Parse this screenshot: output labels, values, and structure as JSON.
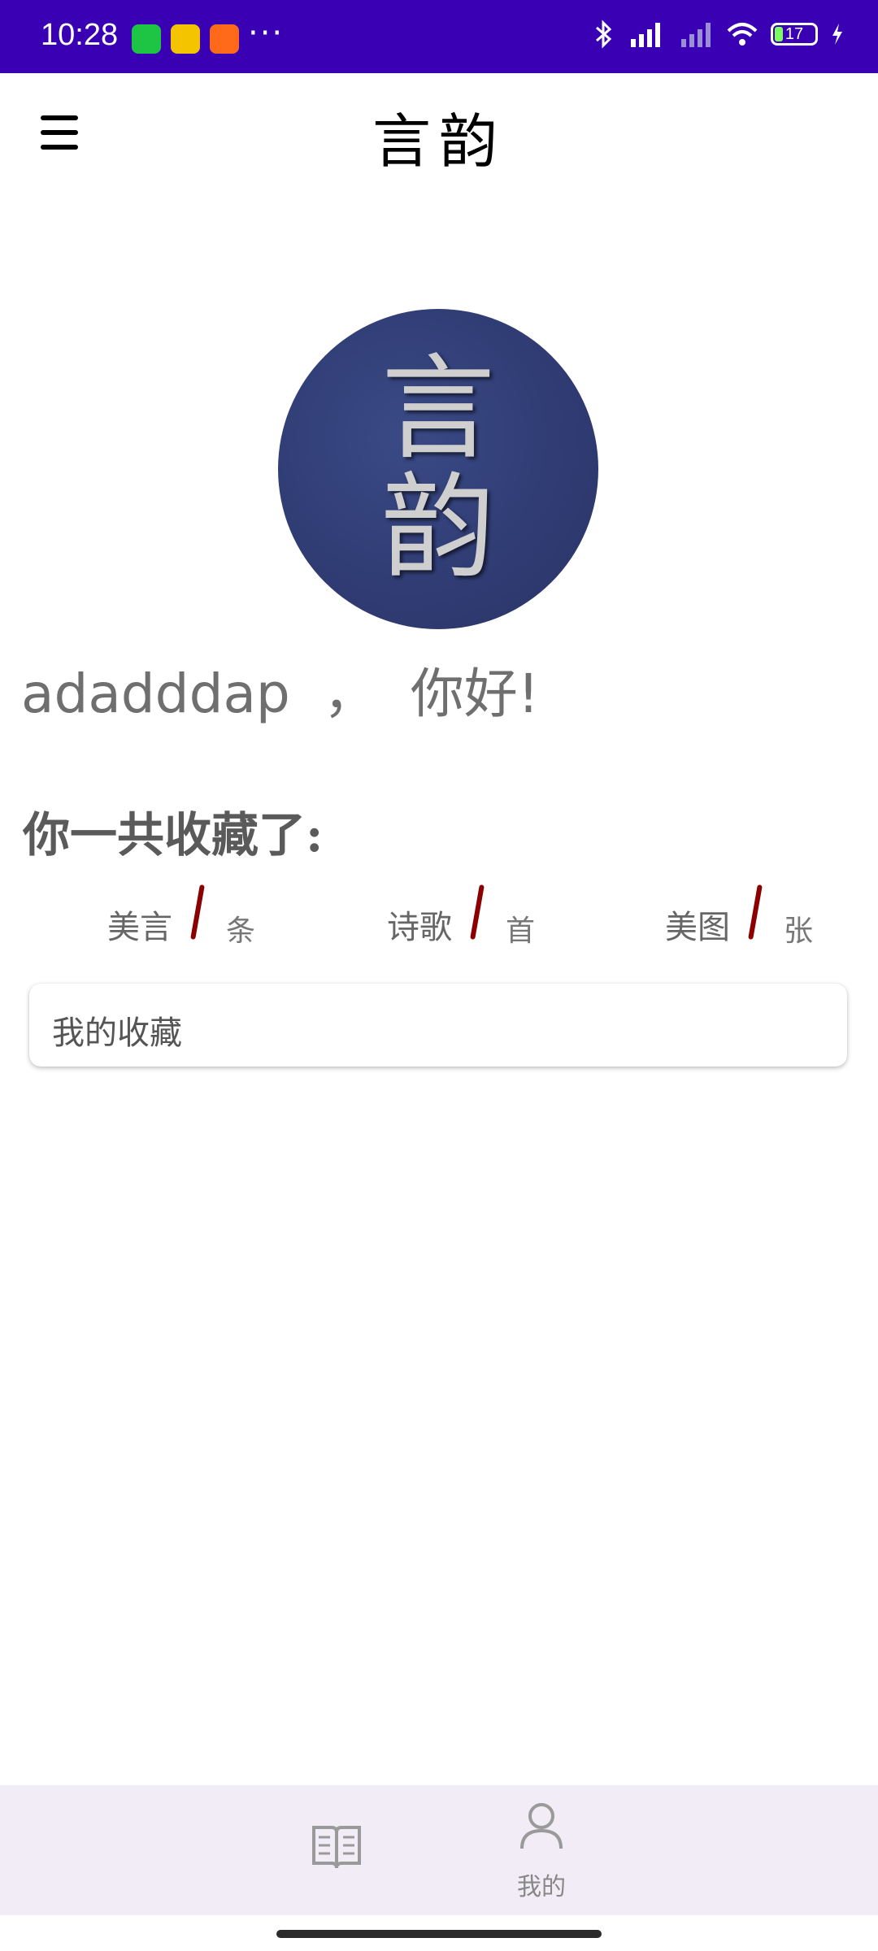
{
  "status_bar": {
    "time": "10:28",
    "apps": [
      "wechat-icon",
      "news-app-icon",
      "video-app-icon"
    ],
    "more": "···",
    "battery_level": "17"
  },
  "app_bar": {
    "menu_icon": "hamburger-menu-icon",
    "title": "言韵"
  },
  "profile": {
    "avatar_chars": [
      "言",
      "韵"
    ],
    "username": "adadddap",
    "separator": "，",
    "greeting": "你好!"
  },
  "stats": {
    "title": "你一共收藏了:",
    "items": [
      {
        "label": "美言",
        "count": "",
        "unit": "条"
      },
      {
        "label": "诗歌",
        "count": "",
        "unit": "首"
      },
      {
        "label": "美图",
        "count": "",
        "unit": "张"
      }
    ]
  },
  "collection": {
    "label": "我的收藏"
  },
  "bottom_nav": {
    "items": [
      {
        "icon": "book-icon",
        "label": ""
      },
      {
        "icon": "person-icon",
        "label": "我的"
      }
    ]
  },
  "colors": {
    "status_bar": "#3a00b4",
    "slash_accent": "#8b0000",
    "bottom_nav_bg": "#f2ecf6"
  }
}
